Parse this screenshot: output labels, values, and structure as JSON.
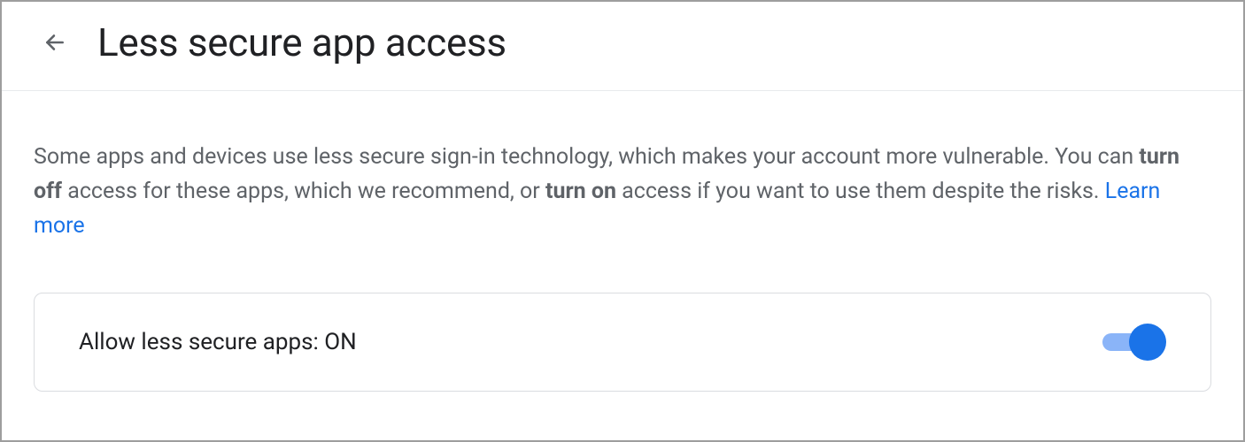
{
  "header": {
    "title": "Less secure app access"
  },
  "content": {
    "desc_part1": "Some apps and devices use less secure sign-in technology, which makes your account more vulnerable. You can ",
    "desc_bold1": "turn off",
    "desc_part2": " access for these apps, which we recommend, or ",
    "desc_bold2": "turn on",
    "desc_part3": " access if you want to use them despite the risks. ",
    "learn_more_label": "Learn more"
  },
  "setting": {
    "label": "Allow less secure apps: ON",
    "state": "ON"
  }
}
